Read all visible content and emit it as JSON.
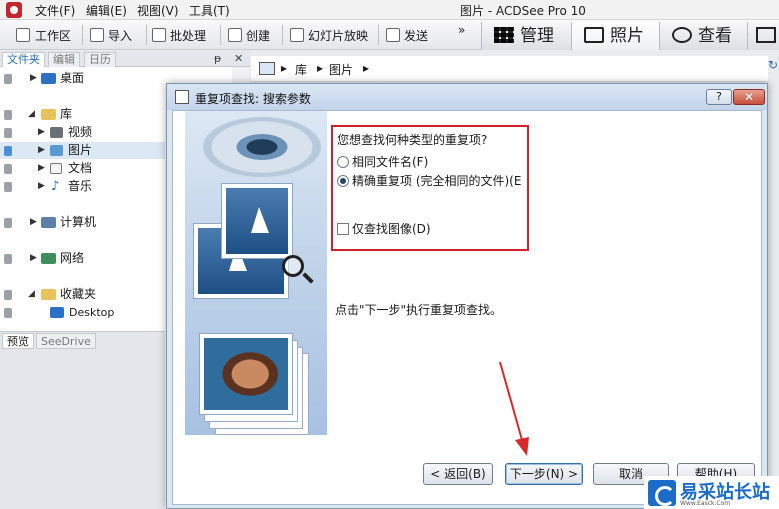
{
  "app": {
    "title": "图片 - ACDSee Pro 10",
    "menu": [
      "文件(F)",
      "编辑(E)",
      "视图(V)",
      "工具(T)"
    ]
  },
  "toolbar": {
    "items": [
      "工作区",
      "导入",
      "批处理",
      "创建",
      "幻灯片放映",
      "发送"
    ],
    "more": "»",
    "modes": [
      "管理",
      "照片",
      "查看"
    ]
  },
  "left_pane": {
    "tabs": [
      "文件夹",
      "编辑",
      "日历"
    ],
    "pin": "ᵽ",
    "close": "✕",
    "tree": [
      {
        "label": "桌面"
      },
      {
        "label": "库"
      },
      {
        "label": "视频"
      },
      {
        "label": "图片"
      },
      {
        "label": "文档"
      },
      {
        "label": "音乐"
      },
      {
        "label": "计算机"
      },
      {
        "label": "网络"
      },
      {
        "label": "收藏夹"
      },
      {
        "label": "Desktop"
      }
    ],
    "bottom_tabs": [
      "预览",
      "SeeDrive"
    ]
  },
  "breadcrumb": {
    "items": [
      "库",
      "图片"
    ],
    "separator": "▸"
  },
  "dialog": {
    "title": "重复项查找: 搜索参数",
    "help": "?",
    "close": "✕",
    "question": "您想查找何种类型的重复项?",
    "options": [
      {
        "label": "相同文件名(F)",
        "selected": false
      },
      {
        "label": "精确重复项 (完全相同的文件)(E",
        "selected": true
      }
    ],
    "checkbox": {
      "label": "仅查找图像(D)",
      "checked": false
    },
    "hint": "点击\"下一步\"执行重复项查找。",
    "buttons": {
      "back": "< 返回(B)",
      "next": "下一步(N) >",
      "cancel": "取消",
      "help": "帮助(H)"
    }
  },
  "watermark": {
    "text": "易采站长站",
    "sub": "Www.Easck.Com"
  },
  "colors": {
    "highlight_box": "#d0242c",
    "arrow": "#d62a2a",
    "dialog_title_bg": "#c3d4ea"
  }
}
